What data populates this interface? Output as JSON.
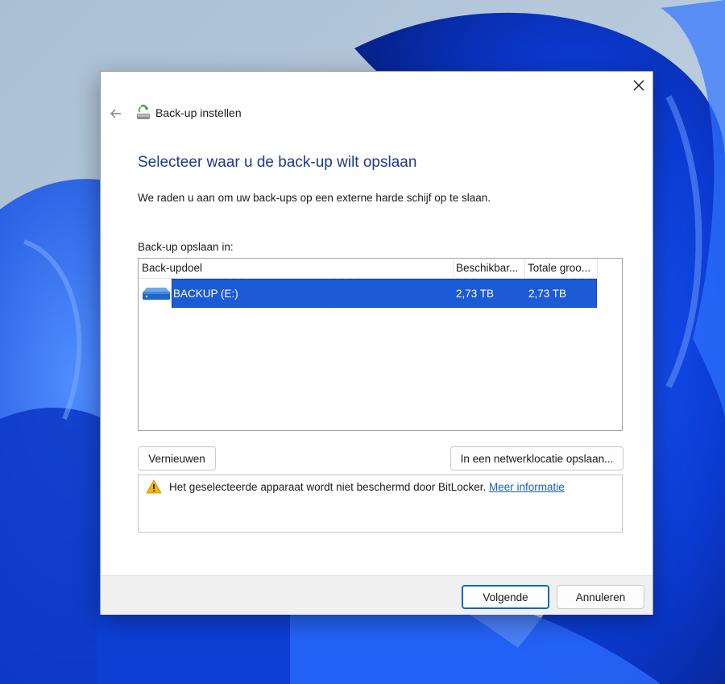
{
  "dialog": {
    "title": "Back-up instellen",
    "heading": "Selecteer waar u de back-up wilt opslaan",
    "subtext": "We raden u aan om uw back-ups op een externe harde schijf op te slaan.",
    "list_label": "Back-up opslaan in:"
  },
  "table": {
    "columns": [
      "Back-updoel",
      "Beschikbar...",
      "Totale groo..."
    ],
    "rows": [
      {
        "name": "BACKUP (E:)",
        "available": "2,73 TB",
        "total": "2,73 TB"
      }
    ]
  },
  "buttons": {
    "refresh": "Vernieuwen",
    "network": "In een netwerklocatie opslaan...",
    "next": "Volgende",
    "cancel": "Annuleren"
  },
  "warning": {
    "text": "Het geselecteerde apparaat wordt niet beschermd door BitLocker.",
    "link": "Meer informatie"
  },
  "icons": {
    "close": "close-icon",
    "back": "back-arrow-icon",
    "app": "backup-app-icon",
    "drive": "hard-drive-icon",
    "warning": "warning-icon"
  },
  "colors": {
    "accent": "#0067c0",
    "selection": "#1c5ad6",
    "heading": "#1d3a8a",
    "link": "#1a5fb4",
    "warning": "#f2b600"
  }
}
